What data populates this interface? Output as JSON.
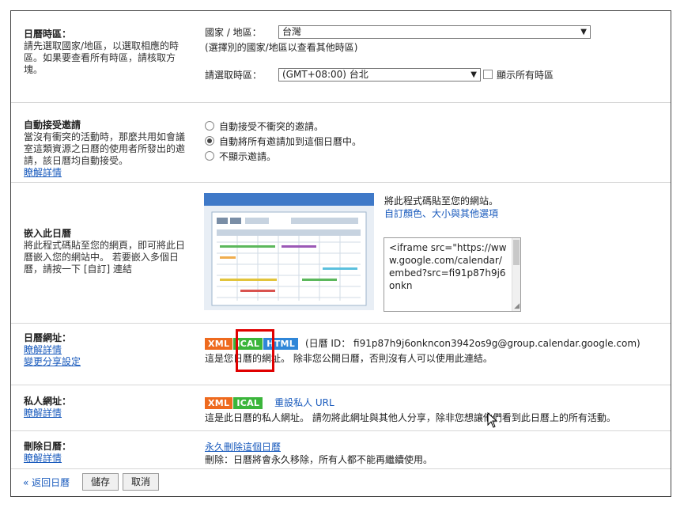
{
  "timezone": {
    "title": "日曆時區：",
    "desc": "請先選取國家/地區，以選取相應的時區。如果要查看所有時區，請核取方塊。",
    "country_label": "國家 / 地區：",
    "country_value": "台灣",
    "country_hint": "(選擇別的國家/地區以查看其他時區)",
    "tz_label": "請選取時區：",
    "tz_value": "(GMT+08:00) 台北",
    "show_all_label": "顯示所有時區"
  },
  "auto_accept": {
    "title": "自動接受邀請",
    "desc": "當沒有衝突的活動時，那麼共用如會議室這類資源之日曆的使用者所發出的邀請，該日曆均自動接受。",
    "learn_more": "瞭解詳情",
    "options": [
      {
        "label": "自動接受不衝突的邀請。",
        "selected": false
      },
      {
        "label": "自動將所有邀請加到這個日曆中。",
        "selected": true
      },
      {
        "label": "不顯示邀請。",
        "selected": false
      }
    ]
  },
  "embed": {
    "title": "嵌入此日曆",
    "desc": "將此程式碼貼至您的網頁，即可將此日曆嵌入您的網站中。 若要嵌入多個日曆，請按一下 [自訂] 連結",
    "paste_hint": "將此程式碼貼至您的網站。",
    "customize_link": "自訂顏色、大小與其他選項",
    "code": "<iframe src=\"https://www.google.com/calendar/embed?src=fi91p87h9j6onkn"
  },
  "calendar_address": {
    "title": "日曆網址：",
    "learn_more": "瞭解詳情",
    "change_sharing": "變更分享設定",
    "badges": {
      "xml": "XML",
      "ical": "ICAL",
      "html": "HTML"
    },
    "calendar_id": "(日曆 ID： fi91p87h9j6onkncon3942os9g@group.calendar.google.com)",
    "note": "這是您日曆的網址。 除非您公開日曆，否則沒有人可以使用此連結。"
  },
  "private_address": {
    "title": "私人網址：",
    "learn_more": "瞭解詳情",
    "badges": {
      "xml": "XML",
      "ical": "ICAL"
    },
    "reset_link": "重設私人 URL",
    "note": "這是此日曆的私人網址。 請勿將此網址與其他人分享，除非您想讓他們看到此日曆上的所有活動。"
  },
  "delete": {
    "title": "刪除日曆：",
    "learn_more": "瞭解詳情",
    "delete_link": "永久刪除這個日曆",
    "note": "刪除：日曆將會永久移除，所有人都不能再繼續使用。"
  },
  "footer": {
    "back_link": "« 返回日曆",
    "save": "儲存",
    "cancel": "取消"
  },
  "colors": {
    "highlight": "#e00000",
    "link": "#1a5bbd",
    "xml": "#ee6a1e",
    "ical": "#3bb53b",
    "html": "#2f86d8"
  }
}
